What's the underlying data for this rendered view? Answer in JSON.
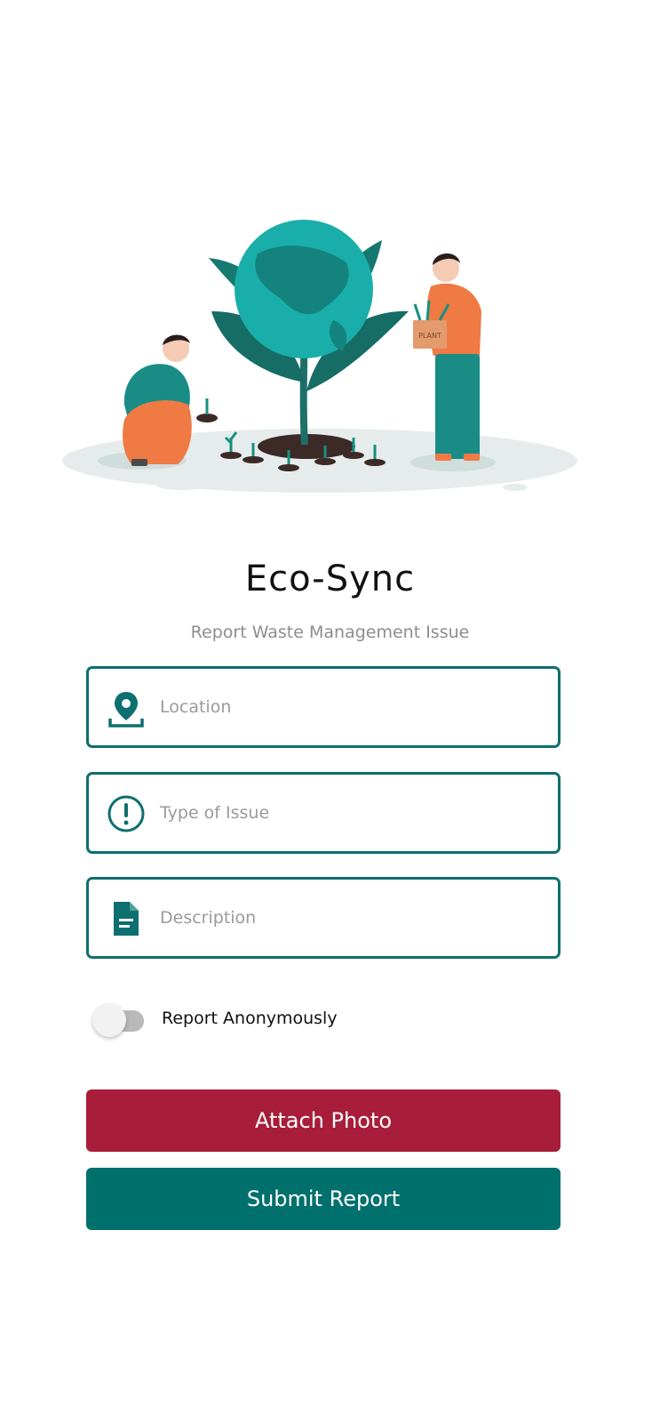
{
  "app": {
    "title": "Eco-Sync",
    "subtitle": "Report Waste Management Issue"
  },
  "hero": {
    "icon": "environment-illustration",
    "box_label": "PLANT"
  },
  "form": {
    "location": {
      "placeholder": "Location",
      "icon": "location-pin-icon"
    },
    "issue": {
      "placeholder": "Type of Issue",
      "icon": "alert-circle-icon"
    },
    "description": {
      "placeholder": "Description",
      "icon": "document-icon"
    }
  },
  "anonymous": {
    "label": "Report Anonymously",
    "enabled": false
  },
  "buttons": {
    "attach_photo": "Attach Photo",
    "submit_report": "Submit Report"
  },
  "colors": {
    "accent": "#0d6f6f",
    "attach_button": "#a81d3a",
    "submit_button": "#00706d",
    "placeholder": "#9a9a9a"
  }
}
